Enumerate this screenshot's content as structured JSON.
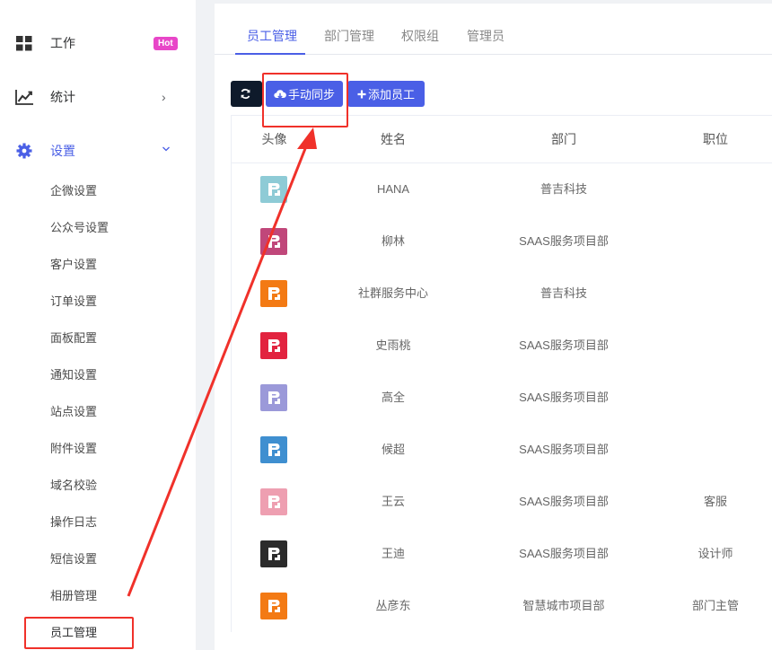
{
  "sidebar": {
    "work": {
      "label": "工作",
      "badge": "Hot"
    },
    "stats": {
      "label": "统计",
      "arrow": "›"
    },
    "settings": {
      "label": "设置",
      "arrow": "⌄"
    },
    "sub_items": [
      "企微设置",
      "公众号设置",
      "客户设置",
      "订单设置",
      "面板配置",
      "通知设置",
      "站点设置",
      "附件设置",
      "域名校验",
      "操作日志",
      "短信设置",
      "相册管理",
      "员工管理"
    ]
  },
  "tabs": [
    "员工管理",
    "部门管理",
    "权限组",
    "管理员"
  ],
  "toolbar": {
    "sync_label": "手动同步",
    "add_label": "添加员工"
  },
  "table": {
    "headers": {
      "avatar": "头像",
      "name": "姓名",
      "dept": "部门",
      "position": "职位"
    },
    "rows": [
      {
        "name": "HANA",
        "dept": "普吉科技",
        "position": "",
        "avatar_color": "#8ecbd6"
      },
      {
        "name": "柳林",
        "dept": "SAAS服务项目部",
        "position": "",
        "avatar_color": "#c0477a"
      },
      {
        "name": "社群服务中心",
        "dept": "普吉科技",
        "position": "",
        "avatar_color": "#f37a14"
      },
      {
        "name": "史雨桃",
        "dept": "SAAS服务项目部",
        "position": "",
        "avatar_color": "#e2233f"
      },
      {
        "name": "高全",
        "dept": "SAAS服务项目部",
        "position": "",
        "avatar_color": "#9b99d9"
      },
      {
        "name": "候超",
        "dept": "SAAS服务项目部",
        "position": "",
        "avatar_color": "#3f8fd0"
      },
      {
        "name": "王云",
        "dept": "SAAS服务项目部",
        "position": "客服",
        "avatar_color": "#ee9fb1"
      },
      {
        "name": "王迪",
        "dept": "SAAS服务项目部",
        "position": "设计师",
        "avatar_color": "#2b2b2b"
      },
      {
        "name": "丛彦东",
        "dept": "智慧城市项目部",
        "position": "部门主管",
        "avatar_color": "#f37a14"
      }
    ]
  },
  "colors": {
    "accent": "#4a5fe6",
    "annotation": "#f0312a",
    "hot": "#e846c8"
  }
}
